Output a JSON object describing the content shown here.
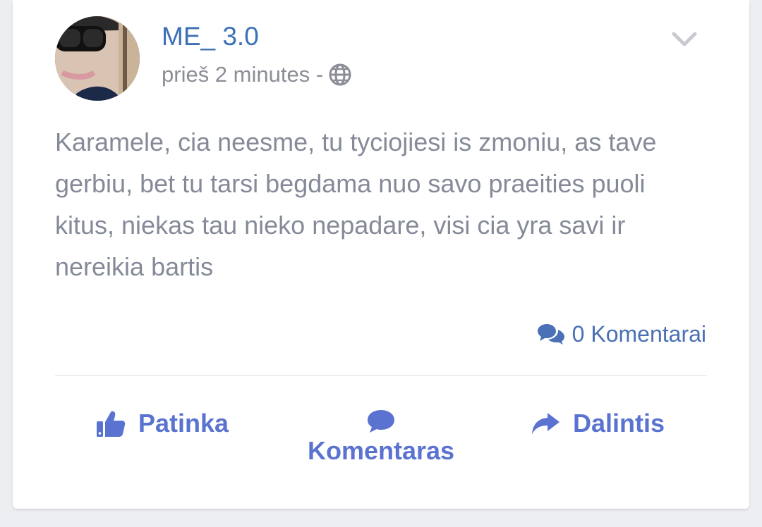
{
  "post": {
    "author": "ME_ 3.0",
    "time": "prieš 2 minutes -",
    "text": "Karamele, cia neesme, tu tyciojiesi is zmoniu, as tave gerbiu, bet tu tarsi begdama nuo savo praeities puoli kitus, niekas tau nieko nepadare, visi cia yra savi ir nereikia bartis",
    "comments_count": "0 Komentarai"
  },
  "actions": {
    "like": "Patinka",
    "comment": "Komentaras",
    "share": "Dalintis"
  },
  "icons": {
    "visibility": "globe-icon",
    "menu": "chevron-down-icon",
    "comments": "comments-icon",
    "like": "thumbs-up-icon",
    "comment": "comment-icon",
    "share": "share-icon"
  },
  "colors": {
    "author": "#3b6fb6",
    "action": "#5b73d0",
    "muted": "#8b8e96"
  }
}
